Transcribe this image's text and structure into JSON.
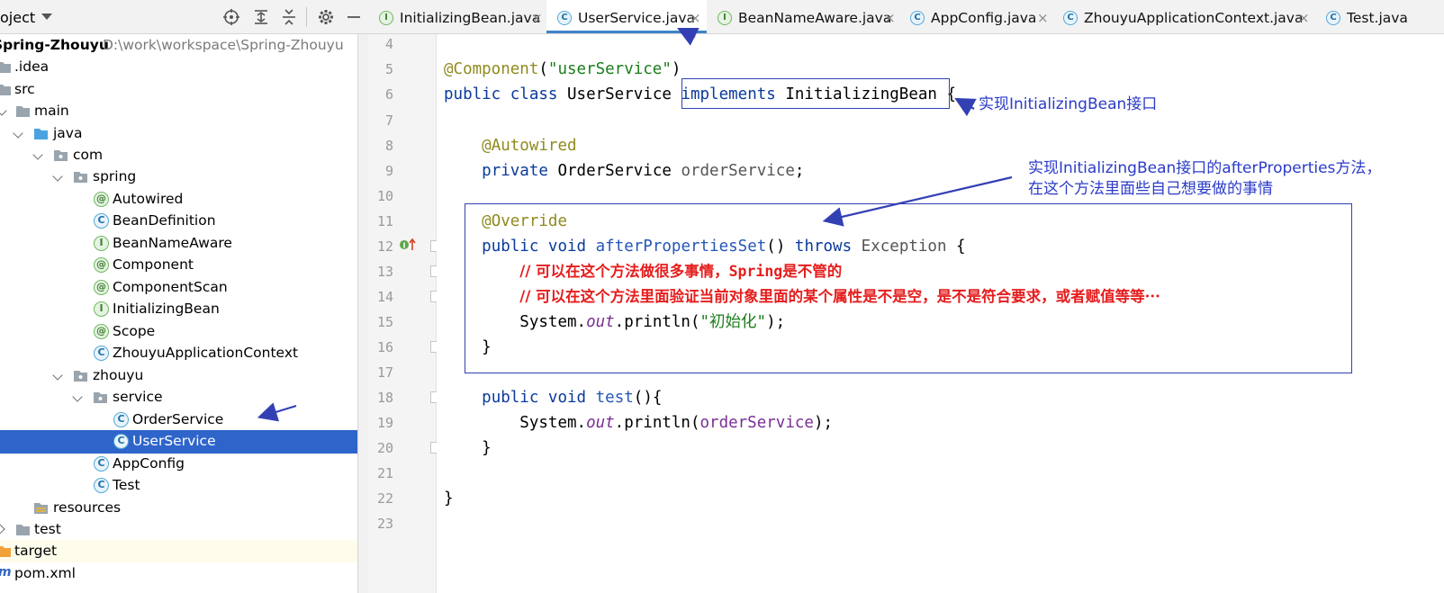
{
  "project": {
    "title": "oject",
    "tree": [
      {
        "label": "Spring-Zhouyu",
        "path": "D:\\work\\workspace\\Spring-Zhouyu",
        "icon": "module-icon",
        "bold": true
      },
      {
        "label": ".idea",
        "icon": "folder-icon"
      },
      {
        "label": "src",
        "icon": "folder-icon"
      },
      {
        "label": "main",
        "icon": "folder-icon"
      },
      {
        "label": "java",
        "icon": "source-folder-icon"
      },
      {
        "label": "com",
        "icon": "package-icon"
      },
      {
        "label": "spring",
        "icon": "package-icon"
      },
      {
        "label": "Autowired",
        "icon": "annotation-icon"
      },
      {
        "label": "BeanDefinition",
        "icon": "class-icon"
      },
      {
        "label": "BeanNameAware",
        "icon": "interface-icon"
      },
      {
        "label": "Component",
        "icon": "annotation-icon"
      },
      {
        "label": "ComponentScan",
        "icon": "annotation-icon"
      },
      {
        "label": "InitializingBean",
        "icon": "interface-icon"
      },
      {
        "label": "Scope",
        "icon": "annotation-icon"
      },
      {
        "label": "ZhouyuApplicationContext",
        "icon": "class-icon"
      },
      {
        "label": "zhouyu",
        "icon": "package-icon"
      },
      {
        "label": "service",
        "icon": "package-icon"
      },
      {
        "label": "OrderService",
        "icon": "class-icon"
      },
      {
        "label": "UserService",
        "icon": "class-icon"
      },
      {
        "label": "AppConfig",
        "icon": "class-icon"
      },
      {
        "label": "Test",
        "icon": "runnable-class-icon"
      },
      {
        "label": "resources",
        "icon": "resources-folder-icon"
      },
      {
        "label": "test",
        "icon": "folder-icon"
      },
      {
        "label": "target",
        "icon": "excluded-folder-icon"
      },
      {
        "label": "pom.xml",
        "icon": "maven-icon"
      }
    ]
  },
  "tabs": [
    {
      "label": "InitializingBean.java",
      "icon": "interface-icon",
      "close": "×"
    },
    {
      "label": "UserService.java",
      "icon": "class-icon",
      "close": "×",
      "active": true
    },
    {
      "label": "BeanNameAware.java",
      "icon": "interface-icon",
      "close": "×"
    },
    {
      "label": "AppConfig.java",
      "icon": "class-icon",
      "close": "×"
    },
    {
      "label": "ZhouyuApplicationContext.java",
      "icon": "class-icon",
      "close": "×"
    },
    {
      "label": "Test.java",
      "icon": "runnable-class-icon",
      "close": ""
    }
  ],
  "editor": {
    "line_numbers": [
      "4",
      "5",
      "6",
      "7",
      "8",
      "9",
      "10",
      "11",
      "12",
      "13",
      "14",
      "15",
      "16",
      "17",
      "18",
      "19",
      "20",
      "21",
      "22",
      "23"
    ],
    "code": {
      "l5_annot": "@Component",
      "l5_open": "(",
      "l5_str": "\"userService\"",
      "l5_close": ")",
      "l6_kw1": "public",
      "l6_kw2": "class",
      "l6_name": "UserService",
      "l6_kw3": "implements",
      "l6_iface": "InitializingBean",
      "l6_brace": "{",
      "l8_annot": "@Autowired",
      "l9_kw": "private",
      "l9_type": "OrderService",
      "l9_field": "orderService",
      "l9_semi": ";",
      "l11_annot": "@Override",
      "l12_kw1": "public",
      "l12_kw2": "void",
      "l12_fn": "afterPropertiesSet",
      "l12_paren": "()",
      "l12_kw3": "throws",
      "l12_ex": "Exception",
      "l12_brace": "{",
      "l13_cmt_a": "// 可以在这个方法做很多事情，",
      "l13_cmt_b": "Spring",
      "l13_cmt_c": "是不管的",
      "l14_cmt": "// 可以在这个方法里面验证当前对象里面的某个属性是不是空，是不是符合要求，或者赋值等等···",
      "l15_obj": "System.",
      "l15_static": "out",
      "l15_call": ".println(",
      "l15_str": "\"初始化\"",
      "l15_end": ");",
      "l16_brace": "}",
      "l18_kw1": "public",
      "l18_kw2": "void",
      "l18_fn": "test",
      "l18_rest": "(){",
      "l19_obj": "System.",
      "l19_static": "out",
      "l19_call": ".println(",
      "l19_field": "orderService",
      "l19_end": ");",
      "l20_brace": "}",
      "l22_brace": "}"
    }
  },
  "annotations": {
    "note1": "实现InitializingBean接口",
    "note2_line1": "实现InitializingBean接口的afterProperties方法，",
    "note2_line2": "在这个方法里面些自己想要做的事情"
  },
  "colors": {
    "selection": "#2f65ca",
    "annotation_ink": "#3340b4",
    "keyword": "#0a3a9c",
    "string": "#1b7d1b",
    "comment": "#e51d1d"
  }
}
